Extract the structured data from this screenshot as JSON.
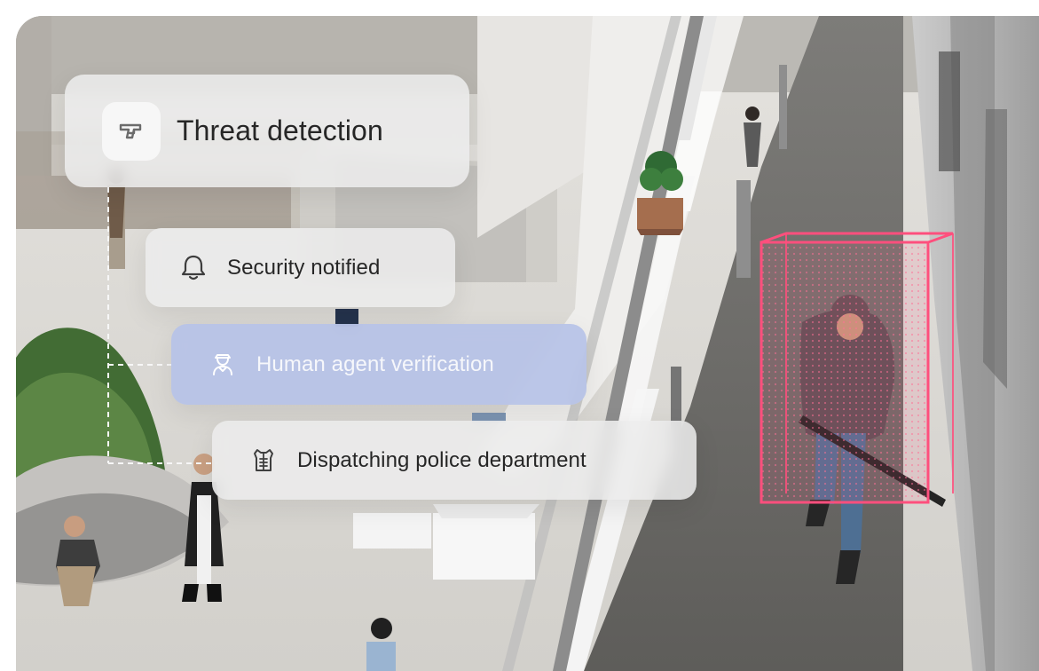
{
  "cards": {
    "threat_detection": {
      "label": "Threat detection",
      "icon": "gun-icon"
    },
    "security_notified": {
      "label": "Security notified",
      "icon": "bell-icon"
    },
    "human_agent_verification": {
      "label": "Human agent verification",
      "icon": "security-guard-icon"
    },
    "dispatching_police_department": {
      "label": "Dispatching police department",
      "icon": "bulletproof-vest-icon"
    }
  },
  "colors": {
    "card_bg": "#ececec",
    "active_card_bg": "#b6c2e7",
    "text_dark": "#262626",
    "text_light": "#f6f7fb",
    "target_box": "#ff4f7d"
  }
}
